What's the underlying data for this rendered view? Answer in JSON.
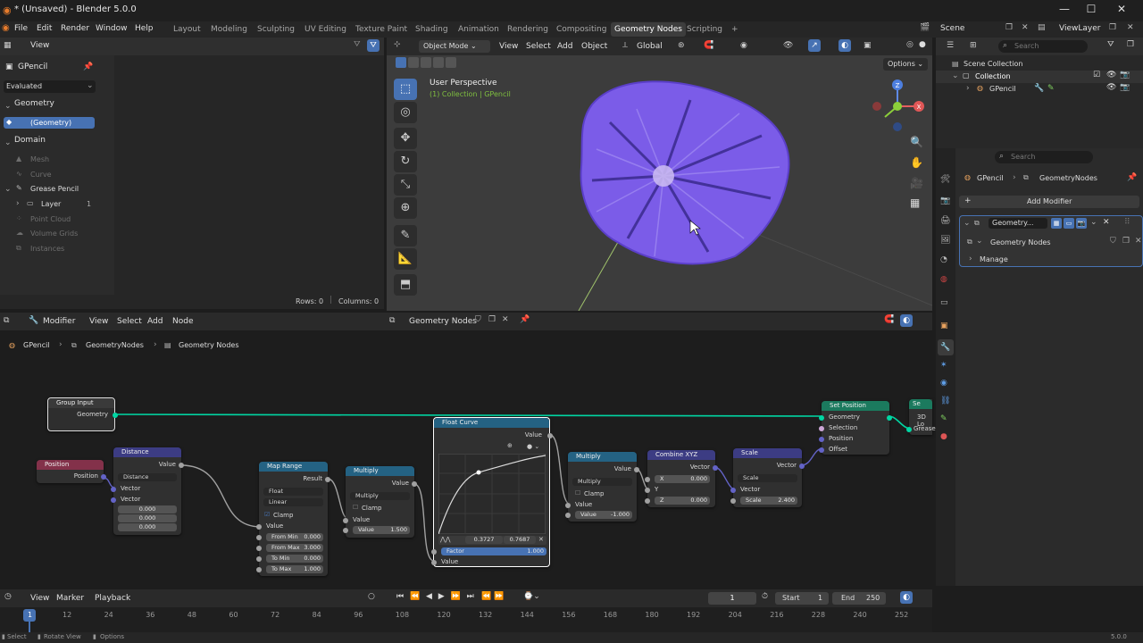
{
  "window": {
    "title": "* (Unsaved) - Blender 5.0.0",
    "min": "—",
    "max": "☐",
    "close": "✕"
  },
  "menu": [
    "File",
    "Edit",
    "Render",
    "Window",
    "Help"
  ],
  "workspaces": [
    "Layout",
    "Modeling",
    "Sculpting",
    "UV Editing",
    "Texture Paint",
    "Shading",
    "Animation",
    "Rendering",
    "Compositing",
    "Geometry Nodes",
    "Scripting"
  ],
  "active_workspace": "Geometry Nodes",
  "scene": "Scene",
  "viewlayer": "ViewLayer",
  "spreadsheet": {
    "view_label": "View",
    "object": "GPencil",
    "evaluated": "Evaluated",
    "geometry_header": "Geometry",
    "geometry_item": "(Geometry)",
    "domain_header": "Domain",
    "domain_items": {
      "mesh": "Mesh",
      "curve": "Curve",
      "grease_pencil": "Grease Pencil",
      "layer": "Layer",
      "layer_count": "1",
      "point_cloud": "Point Cloud",
      "volume_grids": "Volume Grids",
      "instances": "Instances"
    },
    "rows": "Rows: 0",
    "columns": "Columns: 0"
  },
  "viewport": {
    "mode": "Object Mode",
    "menus": [
      "View",
      "Select",
      "Add",
      "Object"
    ],
    "orientation": "Global",
    "options": "Options",
    "perspective": "User Perspective",
    "collection_info": "(1) Collection | GPencil",
    "gizmo": {
      "z": "Z",
      "x": "X"
    }
  },
  "outliner": {
    "search_placeholder": "Search",
    "scene_collection": "Scene Collection",
    "collection": "Collection",
    "object": "GPencil"
  },
  "properties": {
    "search_placeholder": "Search",
    "breadcrumb_obj": "GPencil",
    "breadcrumb_mod": "GeometryNodes",
    "add_modifier": "Add Modifier",
    "modifier_name": "Geometry...",
    "node_group": "Geometry Nodes",
    "manage": "Manage"
  },
  "node_editor": {
    "editor_label": "Modifier",
    "menus": [
      "View",
      "Select",
      "Add",
      "Node"
    ],
    "group_name": "Geometry Nodes",
    "breadcrumb": [
      "GPencil",
      "GeometryNodes",
      "Geometry Nodes"
    ],
    "nodes": {
      "group_input": {
        "title": "Group Input",
        "geometry": "Geometry"
      },
      "position": {
        "title": "Position",
        "out": "Position"
      },
      "distance": {
        "title": "Distance",
        "out": "Value",
        "mode": "Distance",
        "in1": "Vector",
        "in2": "Vector",
        "v1": "0.000",
        "v2": "0.000",
        "v3": "0.000"
      },
      "map_range": {
        "title": "Map Range",
        "out": "Result",
        "type": "Float",
        "interp": "Linear",
        "clamp": "Clamp",
        "value": "Value",
        "from_min_l": "From Min",
        "from_min": "0.000",
        "from_max_l": "From Max",
        "from_max": "3.000",
        "to_min_l": "To Min",
        "to_min": "0.000",
        "to_max_l": "To Max",
        "to_max": "1.000"
      },
      "multiply1": {
        "title": "Multiply",
        "out": "Value",
        "op": "Multiply",
        "clamp": "Clamp",
        "value_l": "Value",
        "value2_l": "Value",
        "value2": "1.500"
      },
      "float_curve": {
        "title": "Float Curve",
        "out": "Value",
        "pt_x": "0.3727",
        "pt_y": "0.7687",
        "factor_l": "Factor",
        "factor": "1.000",
        "value": "Value"
      },
      "multiply2": {
        "title": "Multiply",
        "out": "Value",
        "op": "Multiply",
        "clamp": "Clamp",
        "value_l": "Value",
        "value2_l": "Value",
        "value2": "-1.000"
      },
      "combine_xyz": {
        "title": "Combine XYZ",
        "out": "Vector",
        "x_l": "X",
        "x": "0.000",
        "y_l": "Y",
        "z_l": "Z",
        "z": "0.000"
      },
      "scale": {
        "title": "Scale",
        "out": "Vector",
        "op": "Scale",
        "vec": "Vector",
        "scale_l": "Scale",
        "scale": "2.400"
      },
      "set_position": {
        "title": "Set Position",
        "geometry": "Geometry",
        "selection": "Selection",
        "position": "Position",
        "offset": "Offset"
      },
      "cut_node": {
        "title": "Se",
        "row1": "3D Lo",
        "row2": "Grease"
      }
    }
  },
  "timeline": {
    "menus": [
      "View",
      "Marker",
      "Playback"
    ],
    "current_frame": "1",
    "start_l": "Start",
    "start": "1",
    "end_l": "End",
    "end": "250",
    "ticks": [
      "1",
      "12",
      "24",
      "36",
      "48",
      "60",
      "72",
      "84",
      "96",
      "108",
      "120",
      "132",
      "144",
      "156",
      "168",
      "180",
      "192",
      "204",
      "216",
      "228",
      "240",
      "252"
    ]
  },
  "statusbar": {
    "select": "Select",
    "rotate": "Rotate View",
    "options": "Options",
    "version": "5.0.0"
  },
  "colors": {
    "accent": "#4772b3",
    "active_ws": "#3d3d3d",
    "socket_geometry": "#00d6a3",
    "socket_vector": "#6363c7",
    "socket_float": "#a1a1a1",
    "node_geometry": "#1b7a5e",
    "node_vector": "#3c3c83",
    "node_input": "#83314a",
    "node_converter": "#246283",
    "flower": "#7b5ce8"
  }
}
